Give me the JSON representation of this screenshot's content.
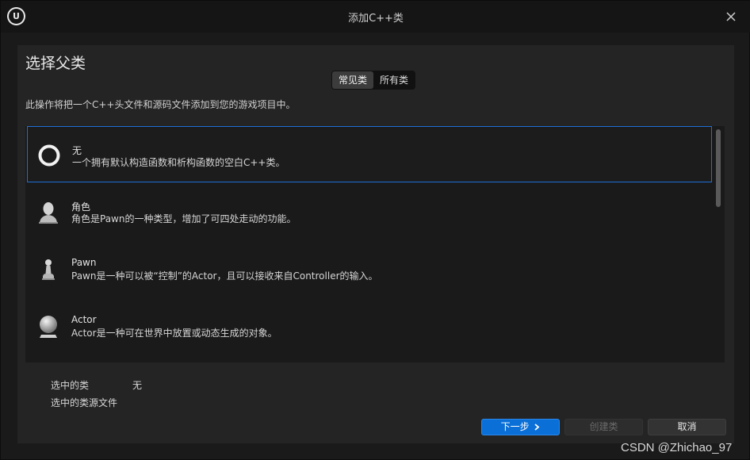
{
  "window": {
    "title": "添加C++类",
    "logo_text": "U"
  },
  "dialog": {
    "heading": "选择父类",
    "tabs": [
      {
        "label": "常见类",
        "active": true
      },
      {
        "label": "所有类",
        "active": false
      }
    ],
    "description": "此操作将把一个C++头文件和源码文件添加到您的游戏项目中。"
  },
  "class_list": [
    {
      "name": "无",
      "description": "一个拥有默认构造函数和析构函数的空白C++类。",
      "icon": "empty-ring-icon",
      "selected": true
    },
    {
      "name": "角色",
      "description": "角色是Pawn的一种类型，增加了可四处走动的功能。",
      "icon": "character-bust-icon",
      "selected": false
    },
    {
      "name": "Pawn",
      "description": "Pawn是一种可以被“控制”的Actor，且可以接收来自Controller的输入。",
      "icon": "pawn-piece-icon",
      "selected": false
    },
    {
      "name": "Actor",
      "description": "Actor是一种可在世界中放置或动态生成的对象。",
      "icon": "sphere-actor-icon",
      "selected": false
    }
  ],
  "selection_info": {
    "selected_class_label": "选中的类",
    "selected_class_value": "无",
    "source_file_label": "选中的类源文件",
    "source_file_value": ""
  },
  "buttons": {
    "next": "下一步",
    "create": "创建类",
    "cancel": "取消"
  },
  "watermark": "CSDN @Zhichao_97",
  "colors": {
    "accent": "#0a70d8",
    "selection_border": "#1e6fd6",
    "background": "#1a1a1a",
    "panel": "#242424"
  }
}
